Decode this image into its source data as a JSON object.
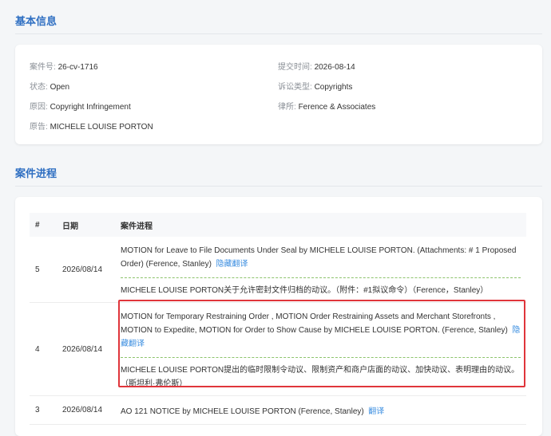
{
  "basic_info": {
    "title": "基本信息",
    "fields": [
      {
        "key": "案件号:",
        "value": "26-cv-1716"
      },
      {
        "key": "提交时间:",
        "value": "2026-08-14"
      },
      {
        "key": "状态:",
        "value": "Open"
      },
      {
        "key": "诉讼类型:",
        "value": "Copyrights"
      },
      {
        "key": "原因:",
        "value": "Copyright Infringement"
      },
      {
        "key": "律所:",
        "value": "Ference & Associates"
      },
      {
        "key": "原告:",
        "value": "MICHELE LOUISE PORTON"
      }
    ]
  },
  "progress": {
    "title": "案件进程",
    "headers": [
      "#",
      "日期",
      "案件进程"
    ],
    "rows": [
      {
        "num": "5",
        "date": "2026/08/14",
        "en": "MOTION for Leave to File Documents Under Seal by MICHELE LOUISE PORTON. (Attachments: # 1 Proposed Order) (Ference, Stanley)",
        "link": "隐藏翻译",
        "zh": "MICHELE LOUISE PORTON关于允许密封文件归档的动议。（附件：#1拟议命令）（Ference，Stanley）"
      },
      {
        "num": "4",
        "date": "2026/08/14",
        "en": "MOTION for Temporary Restraining Order , MOTION Order Restraining Assets and Merchant Storefronts , MOTION to Expedite, MOTION for Order to Show Cause by MICHELE LOUISE PORTON. (Ference, Stanley)",
        "link": "隐藏翻译",
        "zh": "MICHELE LOUISE PORTON提出的临时限制令动议、限制资产和商户店面的动议、加快动议、表明理由的动议。（斯坦利·弗伦斯）"
      },
      {
        "num": "3",
        "date": "2026/08/14",
        "en": "AO 121 NOTICE by MICHELE LOUISE PORTON (Ference, Stanley)",
        "link": "翻译"
      }
    ]
  }
}
